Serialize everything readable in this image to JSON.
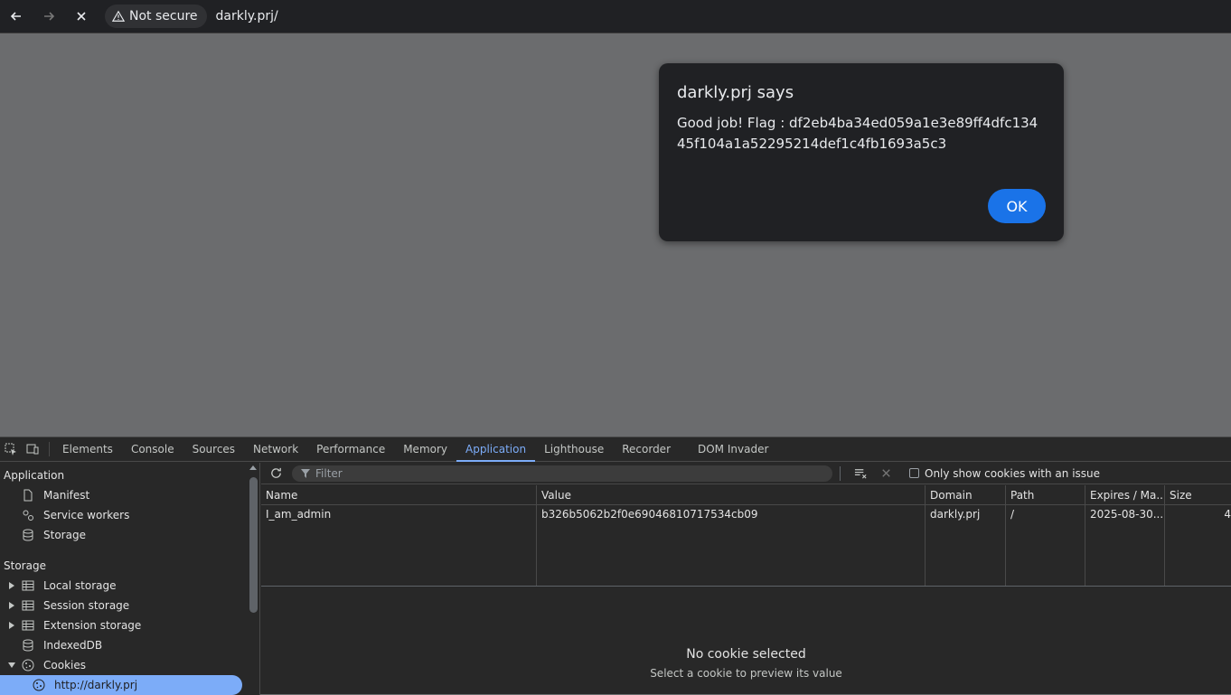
{
  "browser": {
    "security_label": "Not secure",
    "url": "darkly.prj/"
  },
  "dialog": {
    "title": "darkly.prj says",
    "message": "Good job! Flag : df2eb4ba34ed059a1e3e89ff4dfc13445f104a1a52295214def1c4fb1693a5c3",
    "ok_label": "OK"
  },
  "devtools": {
    "tabs": [
      "Elements",
      "Console",
      "Sources",
      "Network",
      "Performance",
      "Memory",
      "Application",
      "Lighthouse",
      "Recorder",
      "DOM Invader"
    ],
    "active_tab": "Application",
    "sidebar": {
      "application_header": "Application",
      "application_items": [
        "Manifest",
        "Service workers",
        "Storage"
      ],
      "storage_header": "Storage",
      "storage_items": [
        "Local storage",
        "Session storage",
        "Extension storage",
        "IndexedDB",
        "Cookies"
      ],
      "cookie_origin": "http://darkly.prj"
    },
    "toolbar": {
      "filter_placeholder": "Filter",
      "only_issues_label": "Only show cookies with an issue"
    },
    "table": {
      "columns": [
        "Name",
        "Value",
        "Domain",
        "Path",
        "Expires / Ma...",
        "Size"
      ],
      "rows": [
        [
          "I_am_admin",
          "b326b5062b2f0e69046810717534cb09",
          "darkly.prj",
          "/",
          "2025-08-30...",
          "4"
        ]
      ]
    },
    "empty_state": {
      "title": "No cookie selected",
      "subtitle": "Select a cookie to preview its value"
    }
  }
}
